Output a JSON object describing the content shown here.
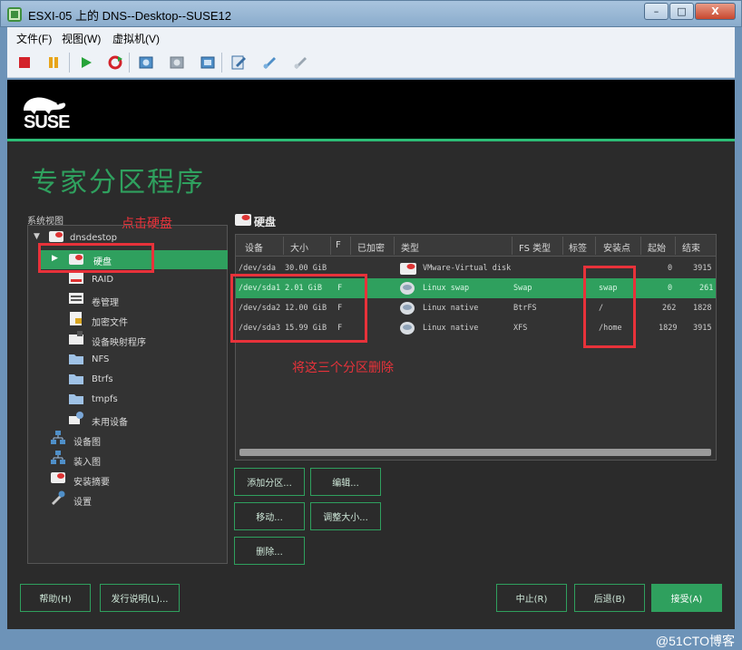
{
  "window": {
    "title": "ESXI-05 上的 DNS--Desktop--SUSE12",
    "controls": [
      "–",
      "□",
      "X"
    ]
  },
  "menu": {
    "items": [
      "文件(F)",
      "视图(W)",
      "虚拟机(V)"
    ]
  },
  "toolbar": {
    "icons": [
      "stop-icon",
      "pause-icon",
      "play-icon",
      "reset-icon",
      "snapshot-icon",
      "snapshot-revert-icon",
      "snapshot-manager-icon",
      "edit-settings-icon",
      "connect-device-icon",
      "tools-icon"
    ]
  },
  "installer": {
    "brand": "SUSE",
    "page_title": "专家分区程序",
    "system_view_label": "系统视图",
    "tree": [
      {
        "label": "dnsdestop",
        "icon": "computer-icon"
      },
      {
        "label": "硬盘",
        "icon": "hard-disk-icon",
        "selected": true
      },
      {
        "label": "RAID",
        "icon": "raid-icon"
      },
      {
        "label": "卷管理",
        "icon": "volume-icon"
      },
      {
        "label": "加密文件",
        "icon": "encrypted-file-icon"
      },
      {
        "label": "设备映射程序",
        "icon": "device-mapper-icon"
      },
      {
        "label": "NFS",
        "icon": "folder-icon"
      },
      {
        "label": "Btrfs",
        "icon": "folder-icon"
      },
      {
        "label": "tmpfs",
        "icon": "folder-icon"
      },
      {
        "label": "未用设备",
        "icon": "unused-device-icon"
      },
      {
        "label": "设备图",
        "icon": "device-graph-icon"
      },
      {
        "label": "装入图",
        "icon": "mount-graph-icon"
      },
      {
        "label": "安装摘要",
        "icon": "summary-icon"
      },
      {
        "label": "设置",
        "icon": "settings-icon"
      }
    ],
    "section_title": "硬盘",
    "table": {
      "columns": [
        "设备",
        "大小",
        "F",
        "已加密",
        "类型",
        "FS 类型",
        "标签",
        "安装点",
        "起始",
        "结束"
      ],
      "rows": [
        {
          "device": "/dev/sda",
          "size": "30.00 GiB",
          "f": "",
          "type": "VMware-Virtual disk",
          "fs": "",
          "mount": "",
          "start": "0",
          "end": "3915",
          "selected": false
        },
        {
          "device": "/dev/sda1",
          "size": "2.01 GiB",
          "f": "F",
          "type": "Linux swap",
          "fs": "Swap",
          "mount": "swap",
          "start": "0",
          "end": "261",
          "selected": true
        },
        {
          "device": "/dev/sda2",
          "size": "12.00 GiB",
          "f": "F",
          "type": "Linux native",
          "fs": "BtrFS",
          "mount": "/",
          "start": "262",
          "end": "1828",
          "selected": false
        },
        {
          "device": "/dev/sda3",
          "size": "15.99 GiB",
          "f": "F",
          "type": "Linux native",
          "fs": "XFS",
          "mount": "/home",
          "start": "1829",
          "end": "3915",
          "selected": false
        }
      ]
    },
    "actions": {
      "add": "添加分区...",
      "edit": "编辑...",
      "move": "移动...",
      "resize": "调整大小...",
      "delete": "删除..."
    },
    "footer": {
      "help": "帮助(H)",
      "release_notes": "发行说明(L)...",
      "abort": "中止(R)",
      "back": "后退(B)",
      "accept": "接受(A)"
    }
  },
  "annotations": {
    "click_disk": "点击硬盘",
    "delete_three": "将这三个分区删除",
    "color": "#e8323a"
  },
  "watermark": "@51CTO博客"
}
